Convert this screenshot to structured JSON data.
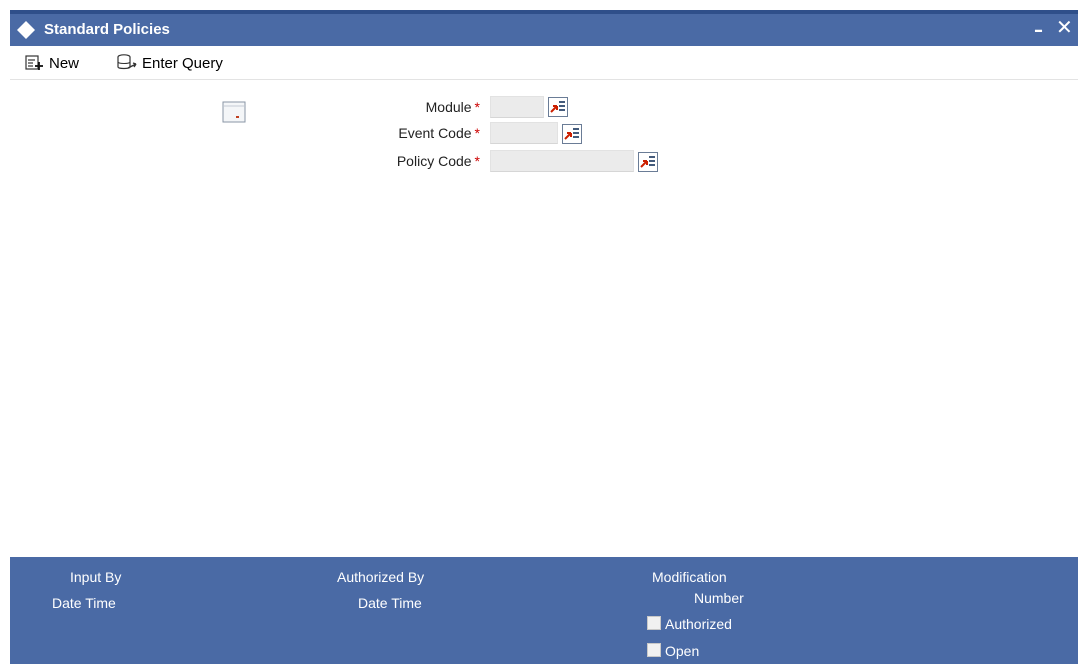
{
  "window": {
    "title": "Standard Policies",
    "icon": "diamond-icon",
    "minimize_label": "–",
    "close_label": "✕"
  },
  "toolbar": {
    "new_label": "New",
    "new_icon": "new-record-icon",
    "enter_query_label": "Enter Query",
    "enter_query_icon": "query-icon"
  },
  "form": {
    "view_icon": "view-details-icon",
    "module": {
      "label": "Module",
      "required_mark": "*",
      "value": ""
    },
    "event_code": {
      "label": "Event Code",
      "required_mark": "*",
      "value": ""
    },
    "policy_code": {
      "label": "Policy Code",
      "required_mark": "*",
      "value": ""
    },
    "lov_icon": "list-of-values-icon"
  },
  "footer": {
    "input_by_label": "Input By",
    "input_date_time_label": "Date Time",
    "authorized_by_label": "Authorized By",
    "authorized_date_time_label": "Date Time",
    "modification_label": "Modification",
    "number_label": "Number",
    "authorized_checkbox_label": "Authorized",
    "open_checkbox_label": "Open",
    "authorized_checked": false,
    "open_checked": false
  },
  "colors": {
    "header_bar": "#4a6aa5",
    "footer_bar": "#4a6aa5",
    "required": "#cc0000",
    "field_bg": "#ebebeb"
  }
}
